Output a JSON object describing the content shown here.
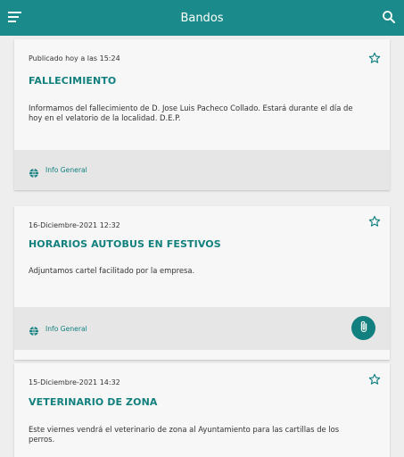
{
  "header": {
    "title": "Bandos",
    "menu_icon": "menu-icon",
    "search_icon": "search-icon"
  },
  "colors": {
    "primary": "#1a8a8a",
    "accent_text": "#12807f",
    "card_bg": "#f7f7f7",
    "footer_bg": "#e6e6e6"
  },
  "cards": [
    {
      "date": "Publicado hoy a las 15:24",
      "title": "FALLECIMIENTO",
      "text": "Informamos del fallecimiento de D. Jose Luis Pacheco Collado. Estará durante el día de hoy en el velatorio de la localidad. D.E.P.",
      "category": "Info General",
      "has_attachment": false
    },
    {
      "date": "16-Diciembre-2021 12:32",
      "title": "HORARIOS AUTOBUS EN FESTIVOS",
      "text": "Adjuntamos cartel facilitado por la empresa.",
      "category": "Info General",
      "has_attachment": true
    },
    {
      "date": "15-Diciembre-2021 14:32",
      "title": "VETERINARIO DE ZONA",
      "text": "Este viernes vendrá el veterinario de zona al Ayuntamiento para las cartillas de los perros.",
      "category": "",
      "has_attachment": false
    }
  ]
}
